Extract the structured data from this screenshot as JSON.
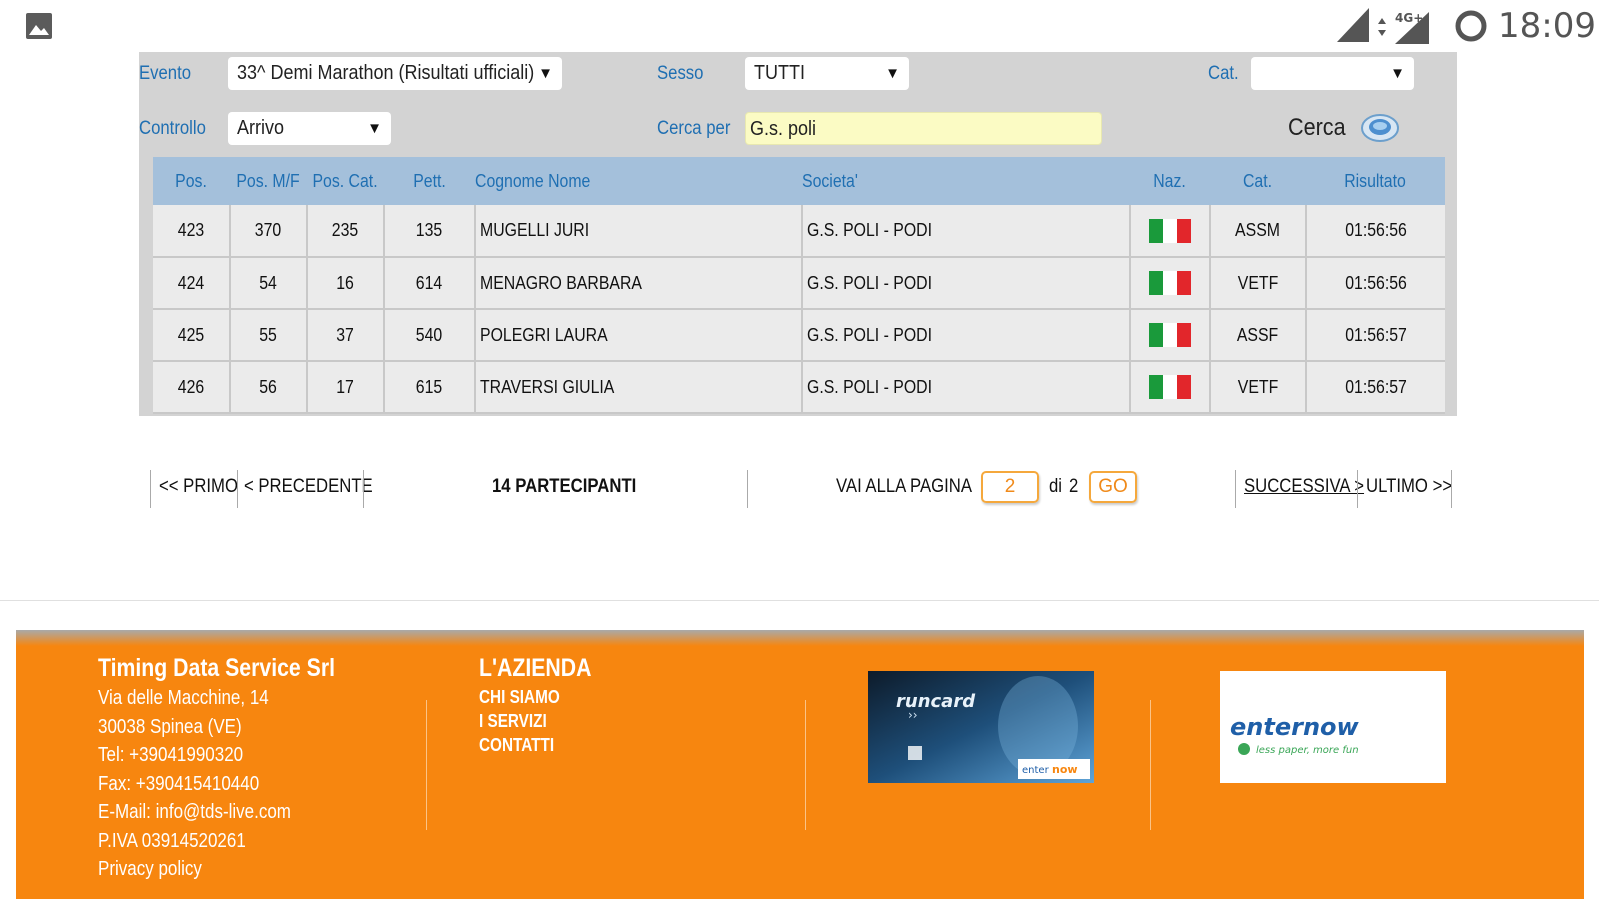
{
  "status_bar": {
    "time": "18:09",
    "network": "4G+",
    "icons": [
      "image-icon",
      "signal-icon",
      "data-icon",
      "battery-icon"
    ]
  },
  "filters": {
    "evento_label": "Evento",
    "evento_value": "33^ Demi Marathon (Risultati ufficiali)",
    "sesso_label": "Sesso",
    "sesso_value": "TUTTI",
    "cat_label": "Cat.",
    "cat_value": "",
    "controllo_label": "Controllo",
    "controllo_value": "Arrivo",
    "cerca_per_label": "Cerca per",
    "cerca_per_value": "G.s. poli",
    "search_label": "Cerca"
  },
  "table": {
    "headers": [
      "Pos.",
      "Pos. M/F",
      "Pos. Cat.",
      "Pett.",
      "Cognome Nome",
      "Societa'",
      "Naz.",
      "Cat.",
      "Risultato"
    ],
    "rows": [
      {
        "pos": "423",
        "pos_mf": "370",
        "pos_cat": "235",
        "pett": "135",
        "name": "MUGELLI JURI",
        "societa": "G.S. POLI - PODI",
        "naz": "ITA",
        "cat": "ASSM",
        "risultato": "01:56:56"
      },
      {
        "pos": "424",
        "pos_mf": "54",
        "pos_cat": "16",
        "pett": "614",
        "name": "MENAGRO BARBARA",
        "societa": "G.S. POLI - PODI",
        "naz": "ITA",
        "cat": "VETF",
        "risultato": "01:56:56"
      },
      {
        "pos": "425",
        "pos_mf": "55",
        "pos_cat": "37",
        "pett": "540",
        "name": "POLEGRI LAURA",
        "societa": "G.S. POLI - PODI",
        "naz": "ITA",
        "cat": "ASSF",
        "risultato": "01:56:57"
      },
      {
        "pos": "426",
        "pos_mf": "56",
        "pos_cat": "17",
        "pett": "615",
        "name": "TRAVERSI GIULIA",
        "societa": "G.S. POLI - PODI",
        "naz": "ITA",
        "cat": "VETF",
        "risultato": "01:56:57"
      }
    ]
  },
  "pagination": {
    "first": "<< PRIMO",
    "prev": "< PRECEDENTE",
    "participants": "14 PARTECIPANTI",
    "goto_label": "VAI ALLA PAGINA",
    "page_value": "2",
    "of_label": "di",
    "total_pages": "2",
    "go": "GO",
    "next": "SUCCESSIVA >",
    "last": "ULTIMO >>"
  },
  "footer": {
    "company": {
      "name": "Timing Data Service Srl",
      "address": "Via delle Macchine, 14",
      "city": "30038 Spinea (VE)",
      "tel": "Tel: +39041990320",
      "fax": "Fax: +390415410440",
      "email": "E-Mail: info@tds-live.com",
      "piva": "P.IVA 03914520261",
      "privacy": "Privacy policy"
    },
    "azienda": {
      "title": "L'AZIENDA",
      "links": [
        "CHI SIAMO",
        "I SERVIZI",
        "CONTATTI"
      ]
    },
    "banners": {
      "runcard": "runcard",
      "enternow_logo": "enternow",
      "enternow_tagline": "less paper, more fun"
    }
  },
  "colors": {
    "accent": "#1f6fb2",
    "panel": "#d3d3d3",
    "header_row": "#a4c0db",
    "footer": "#f7860f",
    "highlight_input": "#fbfbc4"
  }
}
